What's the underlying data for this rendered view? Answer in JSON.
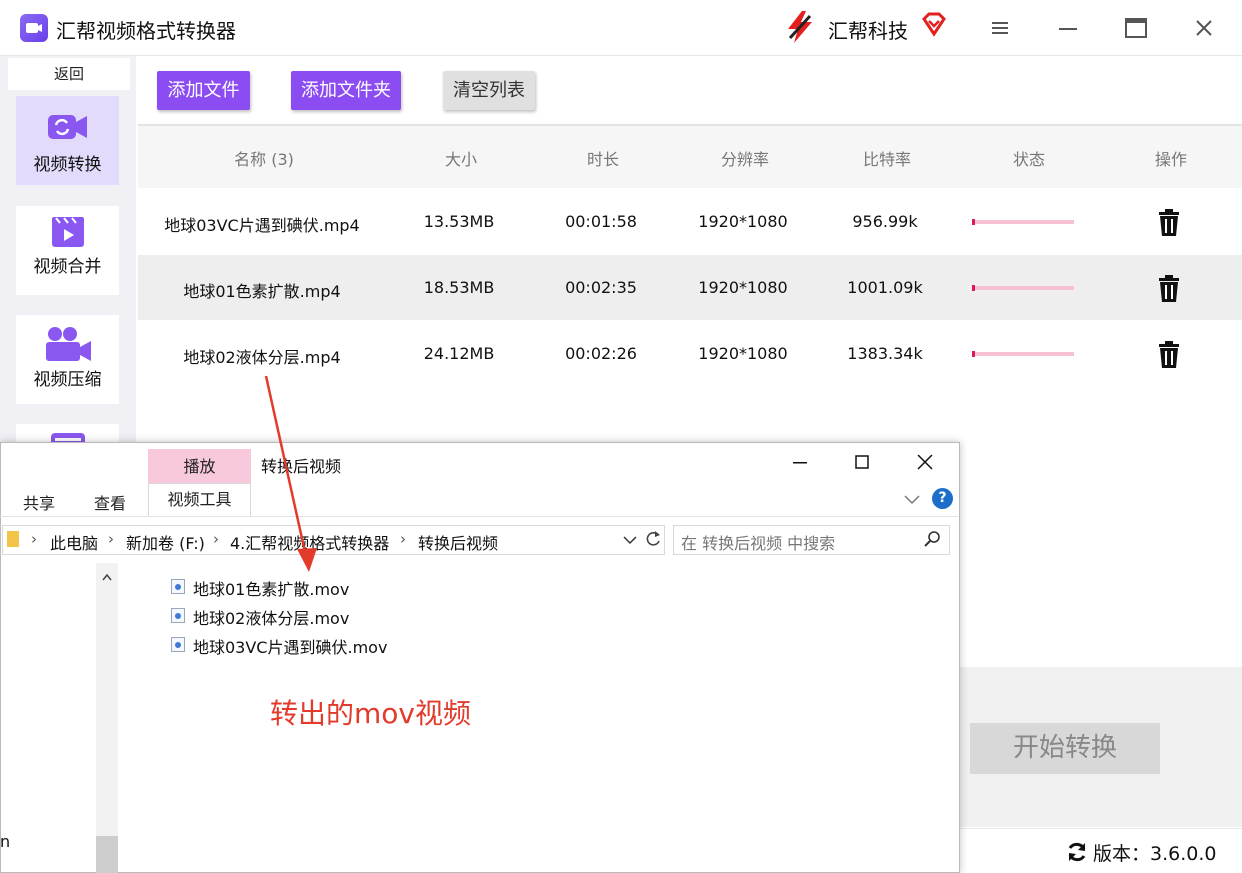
{
  "app": {
    "title": "汇帮视频格式转换器",
    "brand": "汇帮科技"
  },
  "sidebar": {
    "back_label": "返回",
    "items": [
      {
        "label": "视频转换",
        "icon": "video-convert-icon",
        "active": true
      },
      {
        "label": "视频合并",
        "icon": "video-merge-icon",
        "active": false
      },
      {
        "label": "视频压缩",
        "icon": "video-compress-icon",
        "active": false
      }
    ]
  },
  "toolbar": {
    "add_file": "添加文件",
    "add_folder": "添加文件夹",
    "clear_list": "清空列表"
  },
  "table": {
    "headers": [
      "名称 (3)",
      "大小",
      "时长",
      "分辨率",
      "比特率",
      "状态",
      "操作"
    ],
    "rows": [
      {
        "name": "地球03VC片遇到碘伏.mp4",
        "size": "13.53MB",
        "duration": "00:01:58",
        "resolution": "1920*1080",
        "bitrate": "956.99k",
        "progress": 0.02
      },
      {
        "name": "地球01色素扩散.mp4",
        "size": "18.53MB",
        "duration": "00:02:35",
        "resolution": "1920*1080",
        "bitrate": "1001.09k",
        "progress": 0.02
      },
      {
        "name": "地球02液体分层.mp4",
        "size": "24.12MB",
        "duration": "00:02:26",
        "resolution": "1920*1080",
        "bitrate": "1383.34k",
        "progress": 0.02
      }
    ]
  },
  "actions": {
    "start_label": "开始转换"
  },
  "status": {
    "version_label": "版本：3.6.0.0"
  },
  "explorer": {
    "title": "转换后视频",
    "ribbon": {
      "play_tab": "播放",
      "video_tools_tab": "视频工具",
      "share_tab": "共享",
      "view_tab": "查看"
    },
    "breadcrumb": [
      "此电脑",
      "新加卷 (F:)",
      "4.汇帮视频格式转换器",
      "转换后视频"
    ],
    "search_placeholder": "在 转换后视频 中搜索",
    "files": [
      "地球01色素扩散.mov",
      "地球02液体分层.mov",
      "地球03VC片遇到碘伏.mov"
    ],
    "nav_fragment": "n"
  },
  "annotation": {
    "text": "转出的mov视频",
    "color": "#e23b2b"
  },
  "colors": {
    "accent": "#8b4df2",
    "active_nav_bg": "#e2dbfb",
    "progress_track": "#f6c1d3",
    "progress_fill": "#d81b60"
  }
}
